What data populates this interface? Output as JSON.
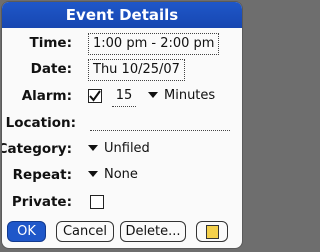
{
  "dialog": {
    "title": "Event Details"
  },
  "fields": {
    "time": {
      "label": "Time:",
      "value": "1:00 pm - 2:00 pm"
    },
    "date": {
      "label": "Date:",
      "value": "Thu 10/25/07"
    },
    "alarm": {
      "label": "Alarm:",
      "checked": true,
      "amount": "15",
      "unit": "Minutes"
    },
    "location": {
      "label": "Location:",
      "value": ""
    },
    "category": {
      "label": "Category:",
      "value": "Unfiled"
    },
    "repeat": {
      "label": "Repeat:",
      "value": "None"
    },
    "private": {
      "label": "Private:",
      "checked": false
    }
  },
  "buttons": {
    "ok": "OK",
    "cancel": "Cancel",
    "delete": "Delete...",
    "note_icon": "note-icon"
  },
  "colors": {
    "title_bar": "#1f57c9",
    "selected_button": "#1f57c9",
    "background": "#fafafa"
  }
}
